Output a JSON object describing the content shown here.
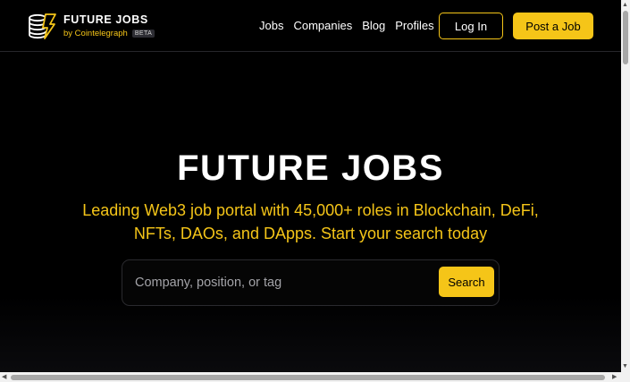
{
  "brand": {
    "title": "FUTURE JOBS",
    "byline": "by Cointelegraph",
    "badge": "BETA",
    "logo_icon": "stacked-coins-lightning-icon",
    "accent_color": "#f5c518"
  },
  "nav": {
    "items": [
      {
        "label": "Jobs"
      },
      {
        "label": "Companies"
      },
      {
        "label": "Blog"
      },
      {
        "label": "Profiles"
      }
    ]
  },
  "header_actions": {
    "login_label": "Log In",
    "post_job_label": "Post a Job"
  },
  "hero": {
    "title": "FUTURE JOBS",
    "subtitle": "Leading Web3 job portal with 45,000+ roles in Blockchain, DeFi, NFTs, DAOs, and DApps. Start your search today"
  },
  "search": {
    "placeholder": "Company, position, or tag",
    "value": "",
    "button_label": "Search"
  }
}
